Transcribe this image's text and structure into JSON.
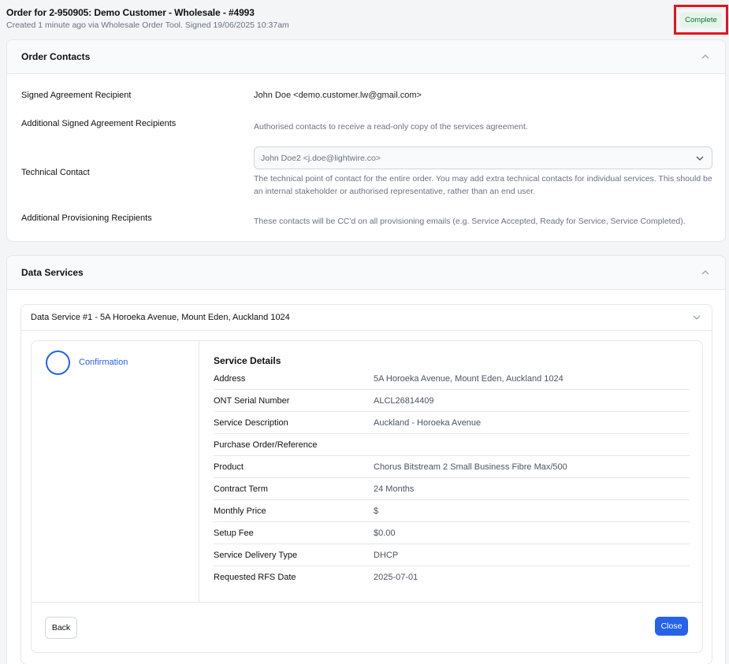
{
  "header": {
    "title": "Order for 2-950905: Demo Customer - Wholesale - #4993",
    "subtitle": "Created 1 minute ago via Wholesale Order Tool. Signed 19/06/2025 10:37am",
    "status": "Complete",
    "status_color": "#1d6b38"
  },
  "order_contacts": {
    "title": "Order Contacts",
    "signed_label": "Signed Agreement Recipient",
    "signed_value": "John Doe <demo.customer.lw@gmail.com>",
    "additional_signed_label": "Additional Signed Agreement Recipients",
    "additional_signed_hint": "Authorised contacts to receive a read-only copy of the services agreement.",
    "technical_label": "Technical Contact",
    "technical_value": "John Doe2 <j.doe@lightwire.co>",
    "technical_hint_1": "The technical point of contact for the entire order. You may add extra technical contacts for individual services. This should be",
    "technical_hint_2": "an internal stakeholder or authorised representative, rather than an end user.",
    "provisioning_label": "Additional Provisioning Recipients",
    "provisioning_hint": "These contacts will be CC'd on all provisioning emails (e.g. Service Accepted, Ready for Service, Service Completed)."
  },
  "data_services": {
    "title": "Data Services",
    "service_title": "Data Service #1 - 5A Horoeka Avenue, Mount Eden, Auckland 1024",
    "step_label": "Confirmation",
    "details_title": "Service Details",
    "details": [
      {
        "label": "Address",
        "value": "5A Horoeka Avenue, Mount Eden, Auckland 1024"
      },
      {
        "label": "ONT Serial Number",
        "value": "ALCL26814409"
      },
      {
        "label": "Service Description",
        "value": "Auckland - Horoeka Avenue"
      },
      {
        "label": "Purchase Order/Reference",
        "value": ""
      },
      {
        "label": "Product",
        "value": "Chorus Bitstream 2 Small Business Fibre Max/500"
      },
      {
        "label": "Contract Term",
        "value": "24 Months"
      },
      {
        "label": "Monthly Price",
        "value": "$"
      },
      {
        "label": "Setup Fee",
        "value": "$0.00"
      },
      {
        "label": "Service Delivery Type",
        "value": "DHCP"
      },
      {
        "label": "Requested RFS Date",
        "value": "2025-07-01"
      }
    ],
    "back_label": "Back",
    "close_label": "Close"
  },
  "colors": {
    "accent": "#2563eb",
    "highlight_border": "#e0161c",
    "status_bg": "#e3f5e8"
  }
}
